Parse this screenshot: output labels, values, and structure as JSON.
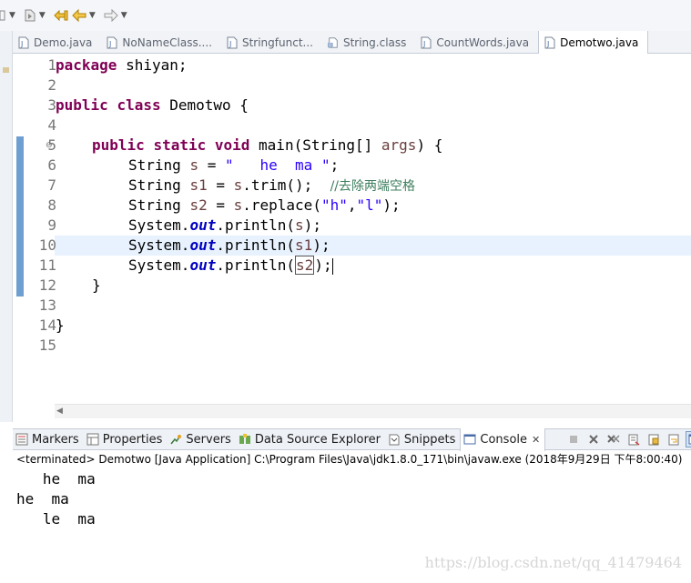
{
  "editor_tabs": [
    {
      "label": "Demo.java",
      "icon": "java-file-icon",
      "active": false
    },
    {
      "label": "NoNameClass....",
      "icon": "java-file-icon",
      "active": false
    },
    {
      "label": "Stringfunct...",
      "icon": "java-file-icon",
      "active": false
    },
    {
      "label": "String.class",
      "icon": "class-file-icon",
      "active": false
    },
    {
      "label": "CountWords.java",
      "icon": "java-file-icon",
      "active": false
    },
    {
      "label": "Demotwo.java",
      "icon": "java-file-icon",
      "active": true
    }
  ],
  "editor": {
    "line_numbers": [
      "1",
      "2",
      "3",
      "4",
      "5",
      "6",
      "7",
      "8",
      "9",
      "10",
      "11",
      "12",
      "13",
      "14",
      "15"
    ],
    "lines": {
      "l1_kw": "package",
      "l1_rest": " shiyan;",
      "l3_kw1": "public",
      "l3_kw2": "class",
      "l3_rest": " Demotwo {",
      "l5_kw1": "public",
      "l5_kw2": "static",
      "l5_kw3": "void",
      "l5_rest1": " main(String[] ",
      "l5_var": "args",
      "l5_rest2": ") {",
      "l6_a": "String ",
      "l6_var": "s",
      "l6_b": " = ",
      "l6_str": "\"   he  ma \"",
      "l6_c": ";",
      "l7_a": "String ",
      "l7_var": "s1",
      "l7_b": " = ",
      "l7_var2": "s",
      "l7_c": ".trim();  ",
      "l7_com": "//去除两端空格",
      "l8_a": "String ",
      "l8_var": "s2",
      "l8_b": " = ",
      "l8_var2": "s",
      "l8_c": ".replace(",
      "l8_str1": "\"h\"",
      "l8_comma": ",",
      "l8_str2": "\"l\"",
      "l8_d": ");",
      "sys": "System.",
      "out": "out",
      "println": ".println(",
      "l9_var": "s",
      "l10_var": "s1",
      "l11_var": "s2",
      "close_paren": ");",
      "l12": "}",
      "l14": "}"
    },
    "current_line": "10"
  },
  "panel_tabs": [
    {
      "label": "Markers",
      "icon": "markers-icon",
      "active": false
    },
    {
      "label": "Properties",
      "icon": "properties-icon",
      "active": false
    },
    {
      "label": "Servers",
      "icon": "servers-icon",
      "active": false
    },
    {
      "label": "Data Source Explorer",
      "icon": "data-source-icon",
      "active": false
    },
    {
      "label": "Snippets",
      "icon": "snippets-icon",
      "active": false
    },
    {
      "label": "Console",
      "icon": "console-icon",
      "active": true
    }
  ],
  "console": {
    "header": "<terminated> Demotwo [Java Application] C:\\Program Files\\Java\\jdk1.8.0_171\\bin\\javaw.exe (2018年9月29日 下午8:00:40)",
    "output": [
      "   he  ma ",
      "he  ma",
      "   le  ma "
    ]
  },
  "watermark": "https://blog.csdn.net/qq_41479464",
  "colors": {
    "keyword": "#7f0055",
    "string": "#2a00ff",
    "comment": "#3f7f5f",
    "static_field": "#0000c0",
    "local_var": "#6a3e3e",
    "current_line_bg": "#e8f2fe"
  }
}
